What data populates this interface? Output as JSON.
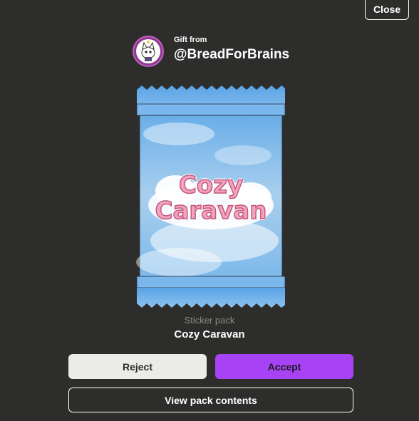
{
  "close_label": "Close",
  "gift": {
    "from_label": "Gift from",
    "username": "@BreadForBrains",
    "avatar_icon": "avatar-icon"
  },
  "pack": {
    "logo_line1": "Cozy",
    "logo_line2": "Caravan",
    "type_label": "Sticker pack",
    "name": "Cozy Caravan"
  },
  "actions": {
    "reject_label": "Reject",
    "accept_label": "Accept",
    "view_contents_label": "View pack contents"
  },
  "colors": {
    "background": "#2d2e2c",
    "accept": "#a742f5",
    "reject": "#ebecea",
    "pack_sky": "#6fb4ec"
  }
}
